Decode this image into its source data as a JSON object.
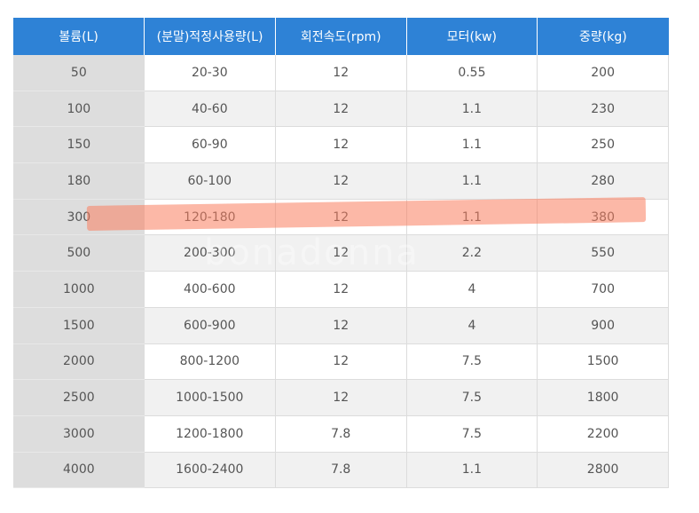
{
  "table": {
    "headers": [
      "볼륨(L)",
      "(분말)적정사용량(L)",
      "회전속도(rpm)",
      "모터(kw)",
      "중량(kg)"
    ],
    "rows": [
      [
        "50",
        "20-30",
        "12",
        "0.55",
        "200"
      ],
      [
        "100",
        "40-60",
        "12",
        "1.1",
        "230"
      ],
      [
        "150",
        "60-90",
        "12",
        "1.1",
        "250"
      ],
      [
        "180",
        "60-100",
        "12",
        "1.1",
        "280"
      ],
      [
        "300",
        "120-180",
        "12",
        "1.1",
        "380"
      ],
      [
        "500",
        "200-300",
        "12",
        "2.2",
        "550"
      ],
      [
        "1000",
        "400-600",
        "12",
        "4",
        "700"
      ],
      [
        "1500",
        "600-900",
        "12",
        "4",
        "900"
      ],
      [
        "2000",
        "800-1200",
        "12",
        "7.5",
        "1500"
      ],
      [
        "2500",
        "1000-1500",
        "12",
        "7.5",
        "1800"
      ],
      [
        "3000",
        "1200-1800",
        "7.8",
        "7.5",
        "2200"
      ],
      [
        "4000",
        "1600-2400",
        "7.8",
        "1.1",
        "2800"
      ]
    ]
  },
  "watermark": "bonadonna",
  "colors": {
    "header_bg": "#2e82d6",
    "highlight": "#fa7d5f"
  }
}
